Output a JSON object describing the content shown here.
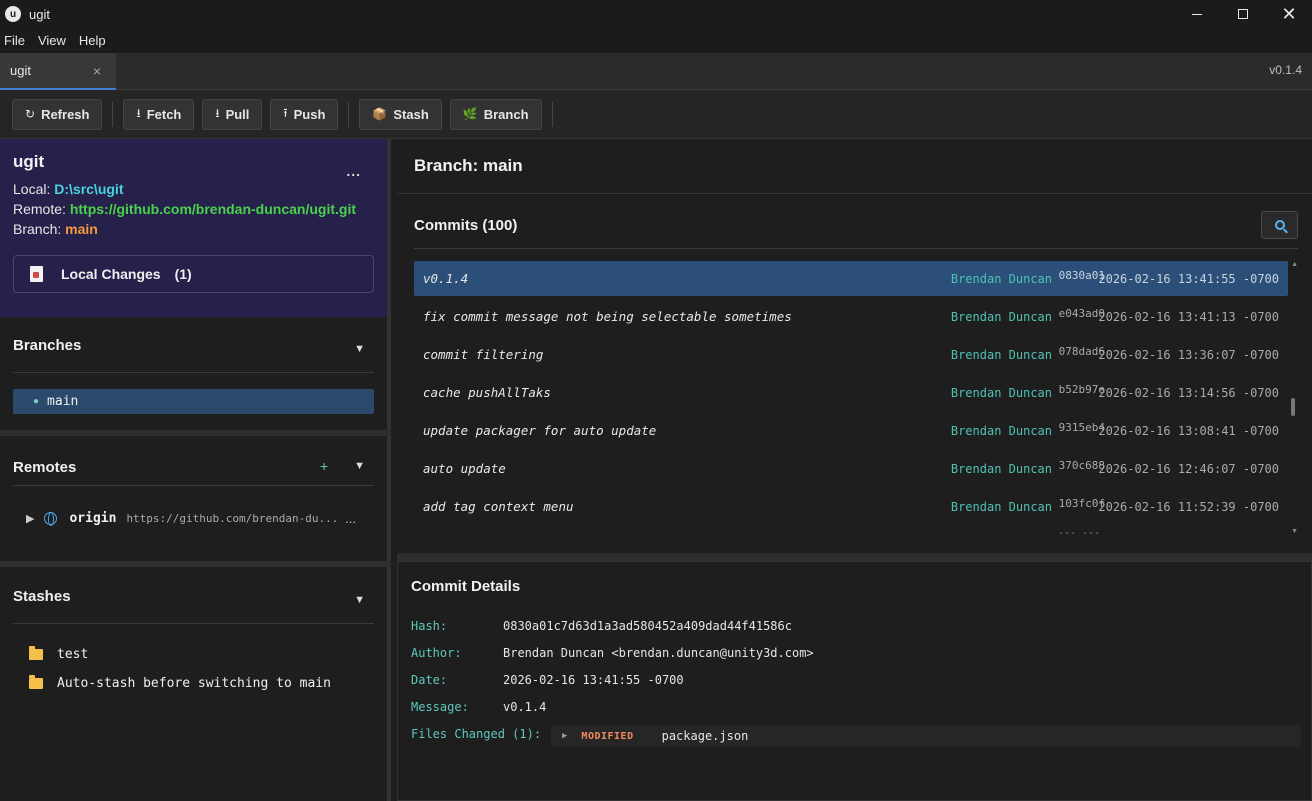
{
  "window": {
    "title": "ugit",
    "logo_glyph": "u"
  },
  "menu": [
    "File",
    "View",
    "Help"
  ],
  "tab": {
    "label": "ugit",
    "close": "×"
  },
  "version": "v0.1.4",
  "toolbar": {
    "refresh": {
      "icon": "↻",
      "label": "Refresh"
    },
    "fetch": {
      "icon": "⭳",
      "label": "Fetch"
    },
    "pull": {
      "icon": "⭳",
      "label": "Pull"
    },
    "push": {
      "icon": "⭱",
      "label": "Push"
    },
    "stash": {
      "icon": "📦",
      "label": "Stash"
    },
    "branch": {
      "icon": "🌿",
      "label": "Branch"
    }
  },
  "repo": {
    "name": "ugit",
    "more": "...",
    "local_label": "Local: ",
    "local_value": "D:\\src\\ugit",
    "remote_label": "Remote: ",
    "remote_value": "https://github.com/brendan-duncan/ugit.git",
    "branch_label": "Branch: ",
    "branch_value": "main",
    "local_changes_label": "Local Changes",
    "local_changes_count": "(1)"
  },
  "branches": {
    "title": "Branches",
    "items": [
      "main"
    ]
  },
  "remotes": {
    "title": "Remotes",
    "add": "+",
    "items": [
      {
        "name": "origin",
        "url": "https://github.com/brendan-du...",
        "more": "..."
      }
    ]
  },
  "stashes": {
    "title": "Stashes",
    "items": [
      "test",
      "Auto-stash before switching to main"
    ]
  },
  "branch_header": "Branch: main",
  "commits": {
    "title": "Commits (100)",
    "rows": [
      {
        "message": "v0.1.4",
        "author": "Brendan Duncan",
        "hash": "0830a01",
        "date": "2026-02-16 13:41:55 -0700",
        "selected": true
      },
      {
        "message": "fix commit message not being selectable sometimes",
        "author": "Brendan Duncan",
        "hash": "e043ad0",
        "date": "2026-02-16 13:41:13 -0700"
      },
      {
        "message": "commit filtering",
        "author": "Brendan Duncan",
        "hash": "078dad6",
        "date": "2026-02-16 13:36:07 -0700"
      },
      {
        "message": "cache pushAllTaks",
        "author": "Brendan Duncan",
        "hash": "b52b97e",
        "date": "2026-02-16 13:14:56 -0700"
      },
      {
        "message": "update packager for auto update",
        "author": "Brendan Duncan",
        "hash": "9315eb4",
        "date": "2026-02-16 13:08:41 -0700"
      },
      {
        "message": "auto update",
        "author": "Brendan Duncan",
        "hash": "370c688",
        "date": "2026-02-16 12:46:07 -0700"
      },
      {
        "message": "add tag context menu",
        "author": "Brendan Duncan",
        "hash": "103fc0f",
        "date": "2026-02-16 11:52:39 -0700"
      }
    ],
    "more_rows": "--- ---"
  },
  "details": {
    "title": "Commit Details",
    "hash_label": "Hash:",
    "hash_value": "0830a01c7d63d1a3ad580452a409dad44f41586c",
    "author_label": "Author:",
    "author_value": "Brendan Duncan <brendan.duncan@unity3d.com>",
    "date_label": "Date:",
    "date_value": "2026-02-16 13:41:55 -0700",
    "message_label": "Message:",
    "message_value": "v0.1.4",
    "files_label": "Files Changed (1):",
    "files": [
      {
        "status": "MODIFIED",
        "name": "package.json"
      }
    ]
  },
  "colors": {
    "accent": "#3e7fd0",
    "selection": "#2b4f78",
    "repo_card": "#25214a",
    "local_path": "#49d3dd",
    "remote_url": "#4cd14c",
    "branch_name": "#f39a3c",
    "author": "#4fc2b3",
    "modified": "#f08a5d"
  },
  "icons": {
    "local_changes": "document-icon",
    "remote": "globe-icon",
    "stash": "folder-icon",
    "search": "search-icon"
  }
}
